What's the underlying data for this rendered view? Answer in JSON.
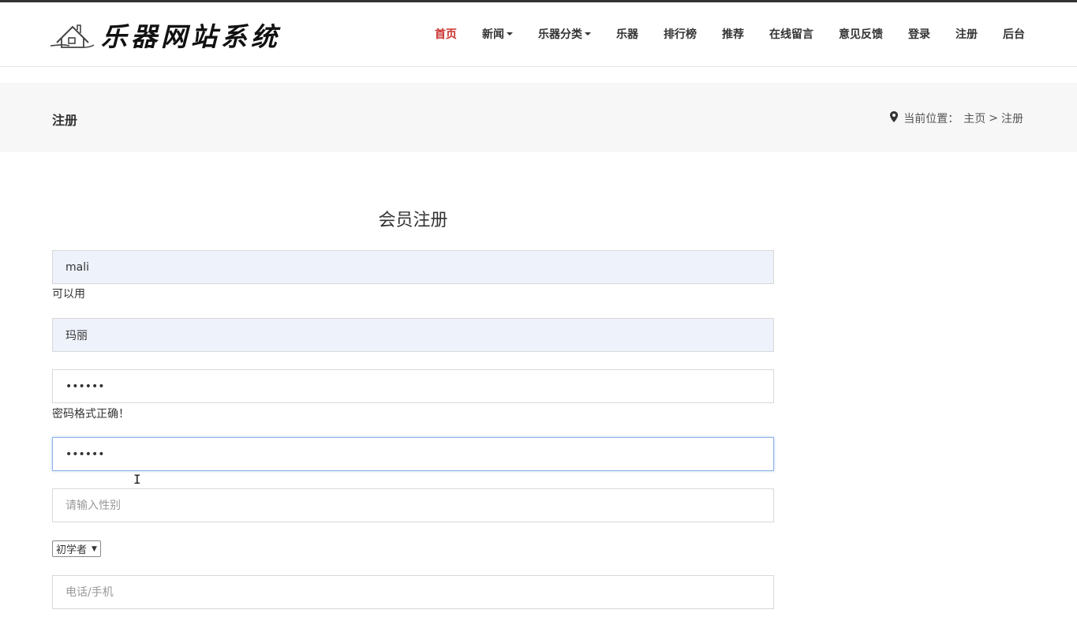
{
  "colors": {
    "accent_active": "#c9302c",
    "band_bg": "#f7f7f8",
    "autofill_bg": "#eef2fb",
    "focus_border": "#8cb4e8"
  },
  "header": {
    "logo_icon": "house-icon",
    "site_title": "乐器网站系统",
    "nav": [
      {
        "label": "首页",
        "active": true,
        "dropdown": false
      },
      {
        "label": "新闻",
        "active": false,
        "dropdown": true
      },
      {
        "label": "乐器分类",
        "active": false,
        "dropdown": true
      },
      {
        "label": "乐器",
        "active": false,
        "dropdown": false
      },
      {
        "label": "排行榜",
        "active": false,
        "dropdown": false
      },
      {
        "label": "推荐",
        "active": false,
        "dropdown": false
      },
      {
        "label": "在线留言",
        "active": false,
        "dropdown": false
      },
      {
        "label": "意见反馈",
        "active": false,
        "dropdown": false
      },
      {
        "label": "登录",
        "active": false,
        "dropdown": false
      },
      {
        "label": "注册",
        "active": false,
        "dropdown": false
      },
      {
        "label": "后台",
        "active": false,
        "dropdown": false
      }
    ]
  },
  "title_band": {
    "heading": "注册",
    "breadcrumb_icon": "map-pin-icon",
    "breadcrumb_prefix": "当前位置：",
    "breadcrumb_home": "主页",
    "breadcrumb_sep": ">",
    "breadcrumb_current": "注册"
  },
  "form": {
    "title": "会员注册",
    "username": {
      "value": "mali",
      "hint": "可以用"
    },
    "realname": {
      "value": "玛丽"
    },
    "password": {
      "value": "••••••",
      "hint": "密码格式正确！"
    },
    "confirm_password": {
      "value": "••••••"
    },
    "gender": {
      "placeholder": "请输入性别"
    },
    "level_select": {
      "selected": "初学者"
    },
    "phone": {
      "placeholder": "电话/手机"
    }
  }
}
